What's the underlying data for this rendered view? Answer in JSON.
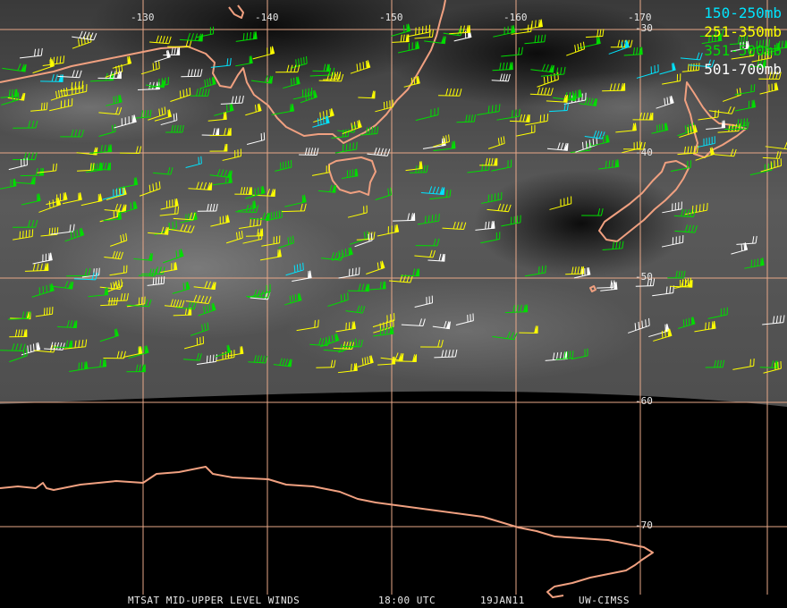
{
  "map": {
    "longitude_labels": [
      "-130",
      "-140",
      "-150",
      "-160",
      "-170"
    ],
    "latitude_labels": [
      "-30",
      "-40",
      "-50",
      "-60",
      "-70"
    ],
    "coast_color": "#f0a080",
    "grid_color": "#e8a888"
  },
  "legend": [
    {
      "label": "150-250mb",
      "color": "#00e5ff"
    },
    {
      "label": "251-350mb",
      "color": "#ffff00"
    },
    {
      "label": "351-500mb",
      "color": "#00dd00"
    },
    {
      "label": "501-700mb",
      "color": "#ffffff"
    }
  ],
  "footer": {
    "product": "MTSAT MID-UPPER LEVEL WINDS",
    "time": "18:00 UTC",
    "date": "19JAN11",
    "source": "UW-CIMSS"
  }
}
